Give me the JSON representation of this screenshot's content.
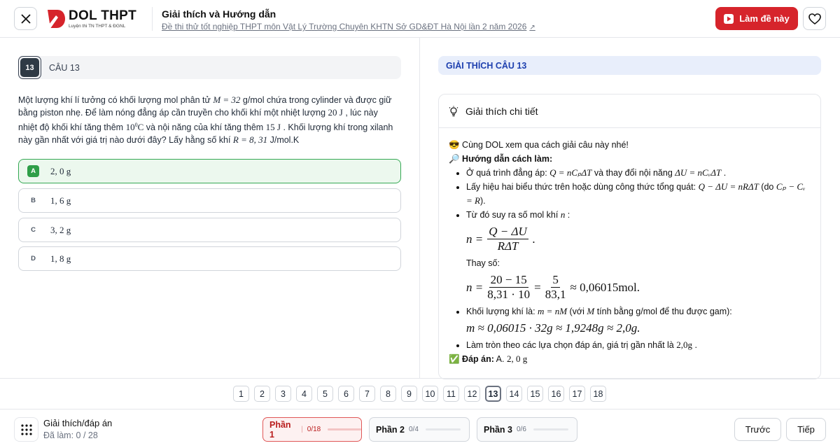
{
  "header": {
    "logo_text": "DOL THPT",
    "logo_sub": "Luyện thi TN THPT & ĐGNL",
    "title": "Giải thích và Hướng dẫn",
    "exam_link": "Đề thi thử tốt nghiệp THPT môn Vật Lý Trường Chuyên KHTN Sở GD&ĐT Hà Nội lần 2 năm 2026",
    "start_label": "Làm đề này",
    "accent": "#d6242b"
  },
  "question": {
    "number": "13",
    "label": "CÂU 13",
    "text_parts": {
      "p1": "Một lượng khí lí tưởng có khối lượng mol phân tử ",
      "p1m": "M = 32",
      "p1u": " g/mol ",
      "p2": " chứa trong cylinder và được giữ bằng piston nhẹ. Để làm nóng đẳng áp cần truyền cho khối khí một nhiệt lượng ",
      "p2m": "20 J",
      "p3": " , lúc này nhiệt độ khối khí tăng thêm ",
      "p3m": "10",
      "p3sup": "0",
      "p3u": "C",
      "p4": " và nội năng của khí tăng thêm ",
      "p4m": "15 J",
      "p5": " . Khối lượng khí trong xilanh này gần nhất với giá trị nào dưới đây? Lấy hằng số khí ",
      "p5m": "R = 8, 31",
      "p5u": " J/mol.K"
    },
    "options": [
      {
        "letter": "A",
        "value": "2, 0 g"
      },
      {
        "letter": "B",
        "value": "1, 6 g"
      },
      {
        "letter": "C",
        "value": "3, 2 g"
      },
      {
        "letter": "D",
        "value": "1, 8 g"
      }
    ]
  },
  "explain": {
    "header": "GIẢI THÍCH CÂU 13",
    "card_title": "Giải thích chi tiết",
    "intro": "😎 Cùng DOL xem qua cách giải câu này nhé!",
    "guide": "🔎 Hướng dẫn cách làm:",
    "b1a": "Ở quá trình đẳng áp:",
    "b1m": "Q = nCₚΔT",
    "b1b": " và thay đổi nội năng ",
    "b1m2": "ΔU = nCᵥΔT",
    "b2a": "Lấy hiệu hai biểu thức trên hoặc dùng công thức tổng quát: ",
    "b2m": "Q − ΔU = nRΔT",
    "b2b": " (do ",
    "b2m2": "Cₚ − Cᵥ = R",
    "b2c": ").",
    "b3a": "Từ đó suy ra số mol khí ",
    "b3m": "n",
    "f1_lhs": "n =",
    "f1_num": "Q − ΔU",
    "f1_den": "RΔT",
    "f1_end": ".",
    "sub_label": "Thay số:",
    "f2_lhs": "n =",
    "f2_num1": "20 − 15",
    "f2_den1": "8,31 · 10",
    "f2_eq": "=",
    "f2_num2": "5",
    "f2_den2": "83,1",
    "f2_rhs": "≈ 0,06015mol.",
    "b4a": "Khối lượng khí là: ",
    "b4m": "m = nM",
    "b4b": " (với ",
    "b4m2": "M",
    "b4c": " tính bằng g/mol để thu được gam):",
    "f3": "m ≈ 0,06015 · 32g ≈ 1,9248g ≈ 2,0g.",
    "b5a": "Làm tròn theo các lựa chọn đáp án, giá trị gần nhất là ",
    "b5m": "2,0g",
    "b5b": " .",
    "answer_label": "✅ Đáp án:",
    "answer_letter": "A.",
    "answer_value": "2, 0 g"
  },
  "pager": [
    "1",
    "2",
    "3",
    "4",
    "5",
    "6",
    "7",
    "8",
    "9",
    "10",
    "11",
    "12",
    "13",
    "14",
    "15",
    "16",
    "17",
    "18"
  ],
  "footer": {
    "title": "Giải thích/đáp án",
    "progress": "Đã làm: 0 / 28",
    "parts": [
      {
        "label": "Phần 1",
        "count": "0/18"
      },
      {
        "label": "Phần 2",
        "count": "0/4"
      },
      {
        "label": "Phần 3",
        "count": "0/6"
      }
    ],
    "prev": "Trước",
    "next": "Tiếp"
  }
}
